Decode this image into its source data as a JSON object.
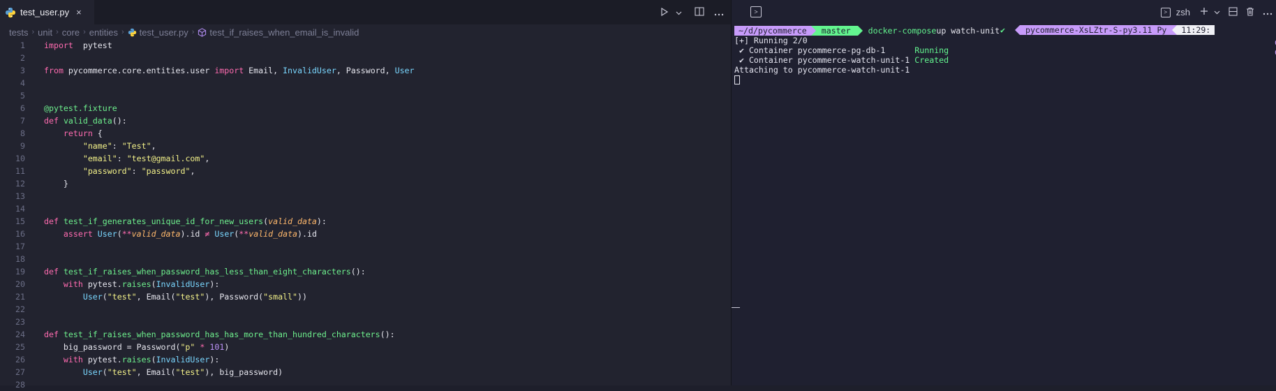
{
  "editor": {
    "tab": {
      "filename": "test_user.py",
      "close": "×"
    },
    "breadcrumb": [
      "tests",
      "unit",
      "core",
      "entities",
      "test_user.py",
      "test_if_raises_when_email_is_invalid"
    ],
    "code": [
      {
        "n": "1",
        "t": [
          [
            "k",
            "import"
          ],
          [
            "",
            "  pytest"
          ]
        ]
      },
      {
        "n": "2",
        "t": []
      },
      {
        "n": "3",
        "t": [
          [
            "k",
            "from"
          ],
          [
            "",
            " pycommerce.core.entities.user "
          ],
          [
            "k",
            "import"
          ],
          [
            "",
            " Email, "
          ],
          [
            "c",
            "InvalidUser"
          ],
          [
            "",
            ", Password, "
          ],
          [
            "c",
            "User"
          ]
        ]
      },
      {
        "n": "4",
        "t": []
      },
      {
        "n": "5",
        "t": []
      },
      {
        "n": "6",
        "t": [
          [
            "d",
            "@pytest.fixture"
          ]
        ]
      },
      {
        "n": "7",
        "t": [
          [
            "k",
            "def"
          ],
          [
            "",
            " "
          ],
          [
            "f",
            "valid_data"
          ],
          [
            "",
            "():"
          ]
        ]
      },
      {
        "n": "8",
        "t": [
          [
            "",
            "    "
          ],
          [
            "k",
            "return"
          ],
          [
            "",
            " {"
          ]
        ]
      },
      {
        "n": "9",
        "t": [
          [
            "",
            "        "
          ],
          [
            "s",
            "\"name\""
          ],
          [
            "",
            ": "
          ],
          [
            "s",
            "\"Test\""
          ],
          [
            "",
            ","
          ]
        ]
      },
      {
        "n": "10",
        "t": [
          [
            "",
            "        "
          ],
          [
            "s",
            "\"email\""
          ],
          [
            "",
            ": "
          ],
          [
            "s",
            "\"test@gmail.com\""
          ],
          [
            "",
            ","
          ]
        ]
      },
      {
        "n": "11",
        "t": [
          [
            "",
            "        "
          ],
          [
            "s",
            "\"password\""
          ],
          [
            "",
            ": "
          ],
          [
            "s",
            "\"password\""
          ],
          [
            "",
            ","
          ]
        ]
      },
      {
        "n": "12",
        "t": [
          [
            "",
            "    }"
          ]
        ]
      },
      {
        "n": "13",
        "t": []
      },
      {
        "n": "14",
        "t": []
      },
      {
        "n": "15",
        "t": [
          [
            "k",
            "def"
          ],
          [
            "",
            " "
          ],
          [
            "f",
            "test_if_generates_unique_id_for_new_users"
          ],
          [
            "",
            "("
          ],
          [
            "p",
            "valid_data"
          ],
          [
            "",
            "):"
          ]
        ]
      },
      {
        "n": "16",
        "t": [
          [
            "",
            "    "
          ],
          [
            "k",
            "assert"
          ],
          [
            "",
            " "
          ],
          [
            "c",
            "User"
          ],
          [
            "",
            "("
          ],
          [
            "o",
            "**"
          ],
          [
            "p",
            "valid_data"
          ],
          [
            "",
            ").id "
          ],
          [
            "o",
            "≠"
          ],
          [
            "",
            " "
          ],
          [
            "c",
            "User"
          ],
          [
            "",
            "("
          ],
          [
            "o",
            "**"
          ],
          [
            "p",
            "valid_data"
          ],
          [
            "",
            ").id"
          ]
        ]
      },
      {
        "n": "17",
        "t": []
      },
      {
        "n": "18",
        "t": []
      },
      {
        "n": "19",
        "t": [
          [
            "k",
            "def"
          ],
          [
            "",
            " "
          ],
          [
            "f",
            "test_if_raises_when_password_has_less_than_eight_characters"
          ],
          [
            "",
            "():"
          ]
        ]
      },
      {
        "n": "20",
        "t": [
          [
            "",
            "    "
          ],
          [
            "k",
            "with"
          ],
          [
            "",
            " pytest."
          ],
          [
            "f",
            "raises"
          ],
          [
            "",
            "("
          ],
          [
            "c",
            "InvalidUser"
          ],
          [
            "",
            "):"
          ]
        ]
      },
      {
        "n": "21",
        "t": [
          [
            "",
            "        "
          ],
          [
            "c",
            "User"
          ],
          [
            "",
            "("
          ],
          [
            "s",
            "\"test\""
          ],
          [
            "",
            ", Email("
          ],
          [
            "s",
            "\"test\""
          ],
          [
            "",
            "), Password("
          ],
          [
            "s",
            "\"small\""
          ],
          [
            "",
            "))"
          ]
        ]
      },
      {
        "n": "22",
        "t": []
      },
      {
        "n": "23",
        "t": []
      },
      {
        "n": "24",
        "t": [
          [
            "k",
            "def"
          ],
          [
            "",
            " "
          ],
          [
            "f",
            "test_if_raises_when_password_has_has_more_than_hundred_characters"
          ],
          [
            "",
            "():"
          ]
        ]
      },
      {
        "n": "25",
        "t": [
          [
            "",
            "    big_password = Password("
          ],
          [
            "s",
            "\"p\""
          ],
          [
            "",
            " "
          ],
          [
            "o",
            "*"
          ],
          [
            "",
            " "
          ],
          [
            "n",
            "101"
          ],
          [
            "",
            ")"
          ]
        ]
      },
      {
        "n": "26",
        "t": [
          [
            "",
            "    "
          ],
          [
            "k",
            "with"
          ],
          [
            "",
            " pytest."
          ],
          [
            "f",
            "raises"
          ],
          [
            "",
            "("
          ],
          [
            "c",
            "InvalidUser"
          ],
          [
            "",
            "):"
          ]
        ]
      },
      {
        "n": "27",
        "t": [
          [
            "",
            "        "
          ],
          [
            "c",
            "User"
          ],
          [
            "",
            "("
          ],
          [
            "s",
            "\"test\""
          ],
          [
            "",
            ", Email("
          ],
          [
            "s",
            "\"test\""
          ],
          [
            "",
            "), big_password)"
          ]
        ]
      },
      {
        "n": "28",
        "t": []
      }
    ]
  },
  "terminal": {
    "shell": "zsh",
    "prompt": {
      "path": "~/d/pycommerce",
      "branch": "master",
      "command": "docker-compose",
      "args": " up watch-unit"
    },
    "right_prompt": {
      "check": "✔",
      "venv": "pycommerce-XsLZtr-S-py3.11 Py",
      "time": "11:29:"
    },
    "lines": [
      {
        "pre": "[+] Running 2/0",
        "status": ""
      },
      {
        "pre": " ✔ Container pycommerce-pg-db-1      ",
        "status": "Running"
      },
      {
        "pre": " ✔ Container pycommerce-watch-unit-1 ",
        "status": "Created"
      },
      {
        "pre": "Attaching to pycommerce-watch-unit-1",
        "status": ""
      }
    ],
    "edge_marks": [
      "C",
      "C"
    ]
  },
  "colors": {
    "keyword": "#ff6bb0",
    "function": "#6ef08d",
    "class": "#7ad7ff",
    "string": "#f3f189",
    "param": "#ffb86c"
  }
}
